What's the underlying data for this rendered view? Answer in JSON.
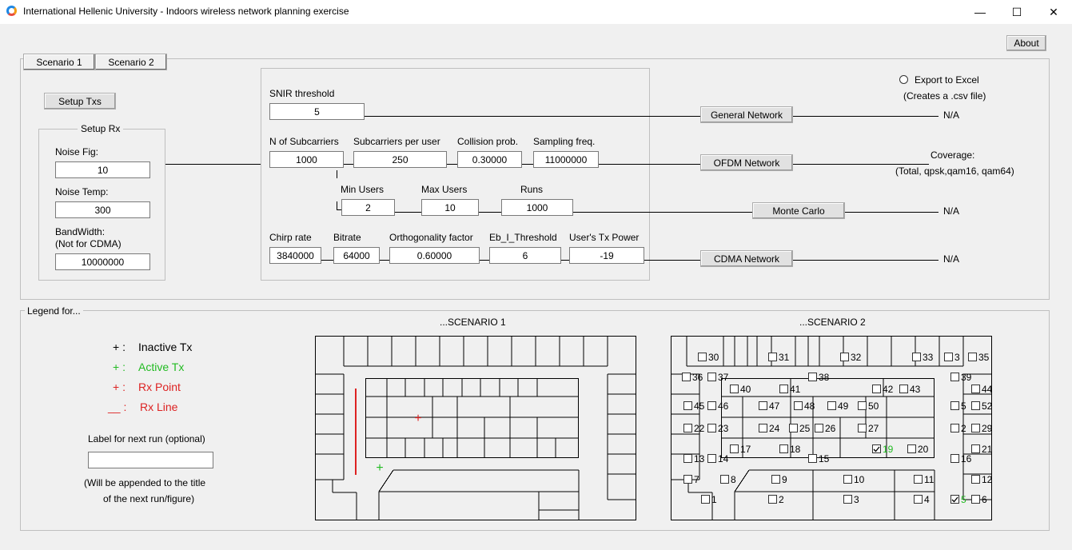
{
  "window": {
    "title": "International Hellenic University - Indoors wireless network planning exercise",
    "minimize": "—",
    "maximize": "☐",
    "close": "✕"
  },
  "about_label": "About",
  "tabs": [
    "Scenario 1",
    "Scenario 2"
  ],
  "setup_txs_label": "Setup Txs",
  "setup_rx": {
    "title": "Setup Rx",
    "noise_fig_label": "Noise Fig:",
    "noise_fig": "10",
    "noise_temp_label": "Noise Temp:",
    "noise_temp": "300",
    "bandwidth_label": "BandWidth:",
    "bandwidth_note": "(Not for CDMA)",
    "bandwidth": "10000000"
  },
  "params": {
    "snir_label": "SNIR threshold",
    "snir": "5",
    "n_subcarriers_label": "N of Subcarriers",
    "n_subcarriers": "1000",
    "subcarriers_per_user_label": "Subcarriers per user",
    "subcarriers_per_user": "250",
    "collision_label": "Collision prob.",
    "collision": "0.30000",
    "sampling_label": "Sampling freq.",
    "sampling": "11000000",
    "min_users_label": "Min Users",
    "min_users": "2",
    "max_users_label": "Max Users",
    "max_users": "10",
    "runs_label": "Runs",
    "runs": "1000",
    "chirp_label": "Chirp rate",
    "chirp": "3840000",
    "bitrate_label": "Bitrate",
    "bitrate": "64000",
    "orth_label": "Orthogonality factor",
    "orth": "0.60000",
    "eb_label": "Eb_I_Threshold",
    "eb": "6",
    "txpower_label": "User's Tx Power",
    "txpower": "-19"
  },
  "networks": {
    "general": "General Network",
    "ofdm": "OFDM Network",
    "monte": "Monte Carlo",
    "cdma": "CDMA Network"
  },
  "results": {
    "general": "N/A",
    "monte": "N/A",
    "cdma": "N/A",
    "coverage_title": "Coverage:",
    "coverage_sub": "(Total, qpsk,qam16, qam64)"
  },
  "export": {
    "label": "Export to Excel",
    "note": "(Creates a .csv file)"
  },
  "legend": {
    "title": "Legend for...",
    "inactive_sym": "+ :",
    "inactive": "Inactive Tx",
    "active_sym": "+ :",
    "active": "Active Tx",
    "rxpoint_sym": "+ :",
    "rxpoint": "Rx Point",
    "rxline_sym": "__ :",
    "rxline": "Rx Line",
    "label_prompt": "Label for next run (optional)",
    "label_value": "",
    "label_note1": "(Will be appended to the title",
    "label_note2": "of the next run/figure)"
  },
  "scenario1_title": "...SCENARIO 1",
  "scenario2_title": "...SCENARIO 2",
  "colors": {
    "active": "#22bb22",
    "rx": "#dd2222"
  },
  "scenario2_tx": [
    {
      "n": "30",
      "checked": false
    },
    {
      "n": "31",
      "checked": false
    },
    {
      "n": "32",
      "checked": false
    },
    {
      "n": "33",
      "checked": false
    },
    {
      "n": "3",
      "checked": false
    },
    {
      "n": "35",
      "checked": false
    },
    {
      "n": "36",
      "checked": false
    },
    {
      "n": "37",
      "checked": false
    },
    {
      "n": "38",
      "checked": false
    },
    {
      "n": "39",
      "checked": false
    },
    {
      "n": "40",
      "checked": false
    },
    {
      "n": "41",
      "checked": false
    },
    {
      "n": "42",
      "checked": false
    },
    {
      "n": "43",
      "checked": false
    },
    {
      "n": "44",
      "checked": false
    },
    {
      "n": "45",
      "checked": false
    },
    {
      "n": "46",
      "checked": false
    },
    {
      "n": "47",
      "checked": false
    },
    {
      "n": "48",
      "checked": false
    },
    {
      "n": "49",
      "checked": false
    },
    {
      "n": "50",
      "checked": false
    },
    {
      "n": "5",
      "checked": false
    },
    {
      "n": "52",
      "checked": false
    },
    {
      "n": "22",
      "checked": false
    },
    {
      "n": "23",
      "checked": false
    },
    {
      "n": "24",
      "checked": false
    },
    {
      "n": "25",
      "checked": false
    },
    {
      "n": "26",
      "checked": false
    },
    {
      "n": "27",
      "checked": false
    },
    {
      "n": "2",
      "checked": false
    },
    {
      "n": "29",
      "checked": false
    },
    {
      "n": "17",
      "checked": false
    },
    {
      "n": "18",
      "checked": false
    },
    {
      "n": "19",
      "checked": true
    },
    {
      "n": "20",
      "checked": false
    },
    {
      "n": "21",
      "checked": false
    },
    {
      "n": "13",
      "checked": false
    },
    {
      "n": "14",
      "checked": false
    },
    {
      "n": "15",
      "checked": false
    },
    {
      "n": "16",
      "checked": false
    },
    {
      "n": "7",
      "checked": false
    },
    {
      "n": "8",
      "checked": false
    },
    {
      "n": "9",
      "checked": false
    },
    {
      "n": "10",
      "checked": false
    },
    {
      "n": "11",
      "checked": false
    },
    {
      "n": "12",
      "checked": false
    },
    {
      "n": "1",
      "checked": false
    },
    {
      "n": "2",
      "checked": false
    },
    {
      "n": "3",
      "checked": false
    },
    {
      "n": "4",
      "checked": false
    },
    {
      "n": "5",
      "checked": true
    },
    {
      "n": "6",
      "checked": false
    }
  ]
}
